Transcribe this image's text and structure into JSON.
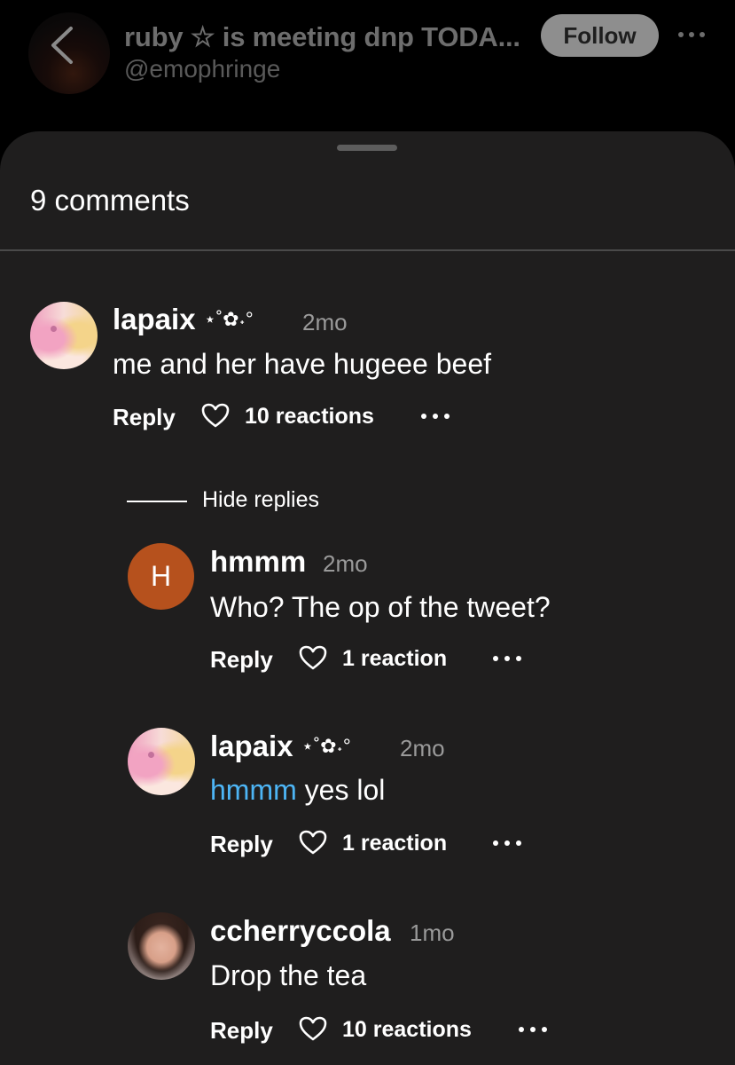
{
  "header": {
    "title": "ruby ☆ is meeting dnp TODA...",
    "handle": "@emophringe",
    "follow_label": "Follow"
  },
  "sheet": {
    "count_label": "9 comments"
  },
  "comments": [
    {
      "name": "lapaix",
      "deco": "⋆˚✿˖°",
      "time": "2mo",
      "text": "me and her have hugeee beef",
      "reply_label": "Reply",
      "reactions": "10 reactions"
    },
    {
      "hide_replies": "Hide replies",
      "name": "hmmm",
      "avatar_letter": "H",
      "time": "2mo",
      "text": "Who? The op of the tweet?",
      "reply_label": "Reply",
      "reactions": "1 reaction"
    },
    {
      "name": "lapaix",
      "deco": "⋆˚✿˖°",
      "time": "2mo",
      "mention": "hmmm",
      "text": " yes lol",
      "reply_label": "Reply",
      "reactions": "1 reaction"
    },
    {
      "name": "ccherryccola",
      "time": "1mo",
      "text": "Drop the tea",
      "reply_label": "Reply",
      "reactions": "10 reactions"
    }
  ],
  "icons": [
    "back-icon",
    "more-icon",
    "heart-icon"
  ],
  "colors": {
    "mention": "#4db5f5",
    "letter_avatar": "#b6511d",
    "sheet_bg": "#1f1e1e"
  }
}
